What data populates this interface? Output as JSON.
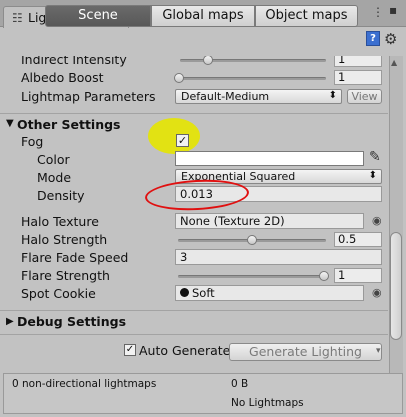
{
  "window": {
    "tab_label": "Lighting",
    "tab_icon": "lighting-icon"
  },
  "toolbar": {
    "tabs": [
      "Scene",
      "Global maps",
      "Object maps"
    ],
    "selected": "Scene",
    "help_label": "?"
  },
  "rows": {
    "indirect_intensity": {
      "label": "Indirect Intensity",
      "value": "1",
      "slider_fraction": 0.2
    },
    "albedo_boost": {
      "label": "Albedo Boost",
      "value": "1",
      "slider_fraction": 0.0
    },
    "lightmap_parameters": {
      "label": "Lightmap Parameters",
      "value": "Default-Medium",
      "view_label": "View"
    }
  },
  "other_settings": {
    "header": "Other Settings",
    "fog": {
      "label": "Fog",
      "checked": true
    },
    "color": {
      "label": "Color",
      "value": "#ffffff"
    },
    "mode": {
      "label": "Mode",
      "value": "Exponential Squared"
    },
    "density": {
      "label": "Density",
      "value": "0.013"
    },
    "halo_texture": {
      "label": "Halo Texture",
      "value": "None (Texture 2D)"
    },
    "halo_strength": {
      "label": "Halo Strength",
      "value": "0.5",
      "slider_fraction": 0.5
    },
    "flare_fade_speed": {
      "label": "Flare Fade Speed",
      "value": "3"
    },
    "flare_strength": {
      "label": "Flare Strength",
      "value": "1",
      "slider_fraction": 1.0
    },
    "spot_cookie": {
      "label": "Spot Cookie",
      "value": "Soft"
    }
  },
  "debug_settings": {
    "header": "Debug Settings"
  },
  "bottom": {
    "auto_generate_label": "Auto Generate",
    "auto_generate_checked": true,
    "generate_label": "Generate Lighting"
  },
  "info": {
    "lightmaps_label": "0 non-directional lightmaps",
    "size": "0 B",
    "status": "No Lightmaps"
  },
  "annotations": {
    "highlight_color": "#e6e600",
    "circle_color": "#e01010"
  }
}
